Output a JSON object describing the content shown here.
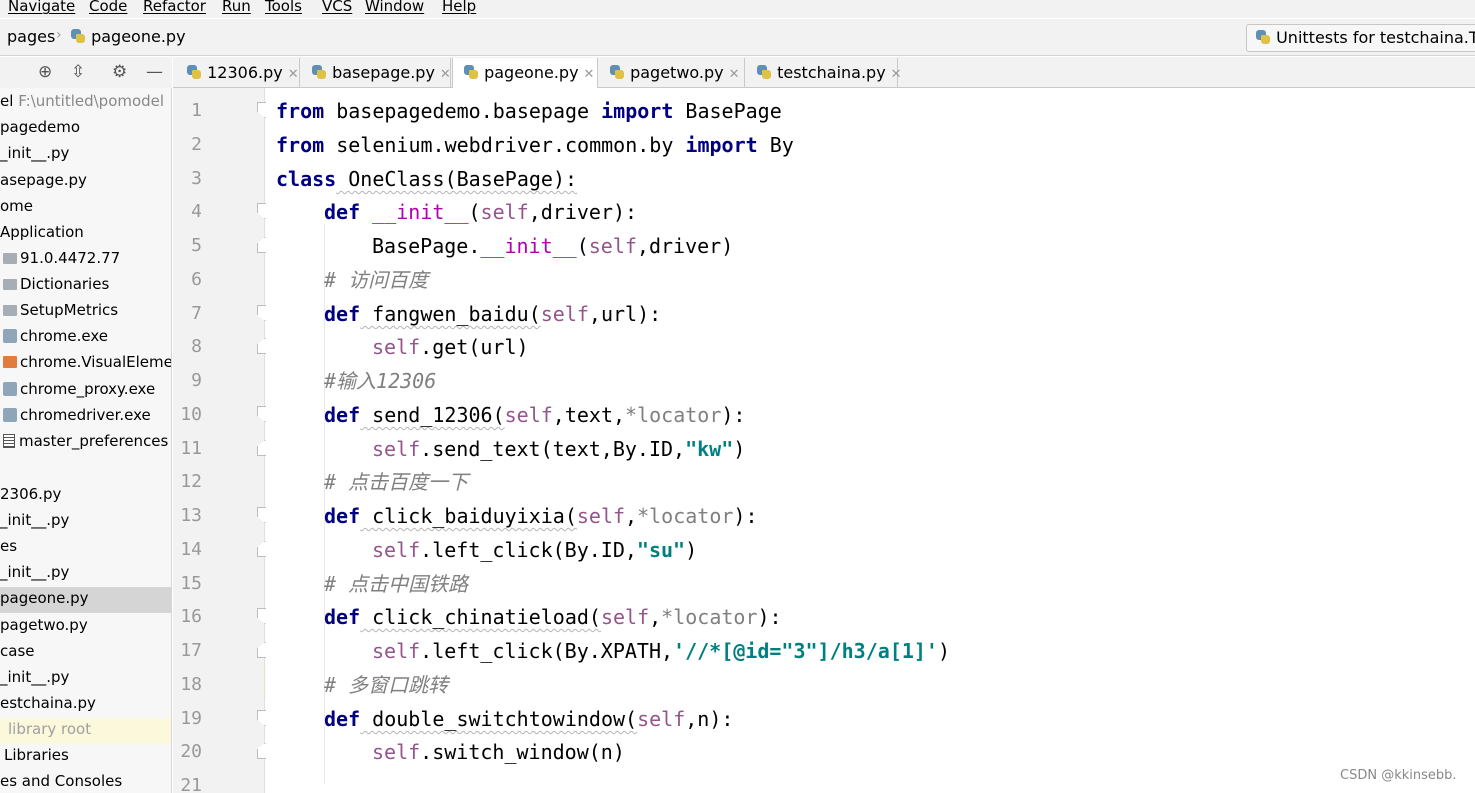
{
  "menu": [
    "Navigate",
    "Code",
    "Refactor",
    "Run",
    "Tools",
    "VCS",
    "Window",
    "Help"
  ],
  "breadcrumb": {
    "folder": "pages",
    "file": "pageone.py"
  },
  "run_config": "Unittests for testchaina.Test",
  "project_tree": [
    {
      "text": "el",
      "extra": "F:\\untitled\\pomodel",
      "icon": ""
    },
    {
      "text": "pagedemo",
      "icon": ""
    },
    {
      "text": "_init__.py",
      "icon": ""
    },
    {
      "text": "asepage.py",
      "icon": ""
    },
    {
      "text": "ome",
      "icon": ""
    },
    {
      "text": "Application",
      "icon": ""
    },
    {
      "text": "91.0.4472.77",
      "icon": "folder"
    },
    {
      "text": "Dictionaries",
      "icon": "folder"
    },
    {
      "text": "SetupMetrics",
      "icon": "folder"
    },
    {
      "text": "chrome.exe",
      "icon": "exe"
    },
    {
      "text": "chrome.VisualElemen",
      "icon": "xml"
    },
    {
      "text": "chrome_proxy.exe",
      "icon": "exe"
    },
    {
      "text": "chromedriver.exe",
      "icon": "exe"
    },
    {
      "text": "master_preferences",
      "icon": "txt"
    },
    {
      "text": "",
      "icon": ""
    },
    {
      "text": "2306.py",
      "icon": ""
    },
    {
      "text": "_init__.py",
      "icon": ""
    },
    {
      "text": "es",
      "icon": ""
    },
    {
      "text": "_init__.py",
      "icon": ""
    },
    {
      "text": "pageone.py",
      "icon": "",
      "selected": true
    },
    {
      "text": "pagetwo.py",
      "icon": ""
    },
    {
      "text": "case",
      "icon": ""
    },
    {
      "text": "_init__.py",
      "icon": ""
    },
    {
      "text": "estchaina.py",
      "icon": ""
    },
    {
      "text": "library root",
      "icon": "",
      "highlight": true
    },
    {
      "text": "Libraries",
      "icon": ""
    },
    {
      "text": "es and Consoles",
      "icon": ""
    }
  ],
  "tabs": [
    {
      "label": "12306.py",
      "active": false
    },
    {
      "label": "basepage.py",
      "active": false
    },
    {
      "label": "pageone.py",
      "active": true
    },
    {
      "label": "pagetwo.py",
      "active": false
    },
    {
      "label": "testchaina.py",
      "active": false
    }
  ],
  "line_numbers": [
    "1",
    "2",
    "3",
    "4",
    "5",
    "6",
    "7",
    "8",
    "9",
    "10",
    "11",
    "12",
    "13",
    "14",
    "15",
    "16",
    "17",
    "18",
    "19",
    "20",
    "21"
  ],
  "code": {
    "l1": {
      "a": "from",
      "b": " basepagedemo.basepage ",
      "c": "import",
      "d": " BasePage"
    },
    "l2": {
      "a": "from",
      "b": " selenium.webdriver.common.by ",
      "c": "import",
      "d": " By"
    },
    "l3": {
      "a": "class",
      "b": " OneClass(BasePage):"
    },
    "l4": {
      "a": "def",
      "b": " ",
      "c": "__init__",
      "d": "(",
      "e": "self",
      "f": ",driver):"
    },
    "l5": {
      "a": "BasePage.",
      "b": "__init__",
      "c": "(",
      "d": "self",
      "e": ",driver)"
    },
    "l6": {
      "a": "# 访问百度"
    },
    "l7": {
      "a": "def",
      "b": " fangwen_baidu(",
      "c": "self",
      "d": ",url):"
    },
    "l8": {
      "a": "self",
      "b": ".get(url)"
    },
    "l9": {
      "a": "#输入12306"
    },
    "l10": {
      "a": "def",
      "b": " send_12306(",
      "c": "self",
      "d": ",text,",
      "e": "*locator",
      "f": "):"
    },
    "l11": {
      "a": "self",
      "b": ".send_text(text,By.ID,",
      "c": "\"kw\"",
      "d": ")"
    },
    "l12": {
      "a": "# 点击百度一下"
    },
    "l13": {
      "a": "def",
      "b": " click_baiduyixia(",
      "c": "self",
      "d": ",",
      "e": "*locator",
      "f": "):"
    },
    "l14": {
      "a": "self",
      "b": ".left_click(By.ID,",
      "c": "\"su\"",
      "d": ")"
    },
    "l15": {
      "a": "# 点击中国铁路"
    },
    "l16": {
      "a": "def",
      "b": " click_chinatieload(",
      "c": "self",
      "d": ",",
      "e": "*locator",
      "f": "):"
    },
    "l17": {
      "a": "self",
      "b": ".left_click(By.XPATH,",
      "c": "'//*[@id=\"3\"]/h3/a[1]'",
      "d": ")"
    },
    "l18": {
      "a": "# 多窗口跳转"
    },
    "l19": {
      "a": "def",
      "b": " double_switchtowindow(",
      "c": "self",
      "d": ",n):"
    },
    "l20": {
      "a": "self",
      "b": ".switch_window(n)"
    }
  },
  "watermark": "CSDN @kkinsebb."
}
